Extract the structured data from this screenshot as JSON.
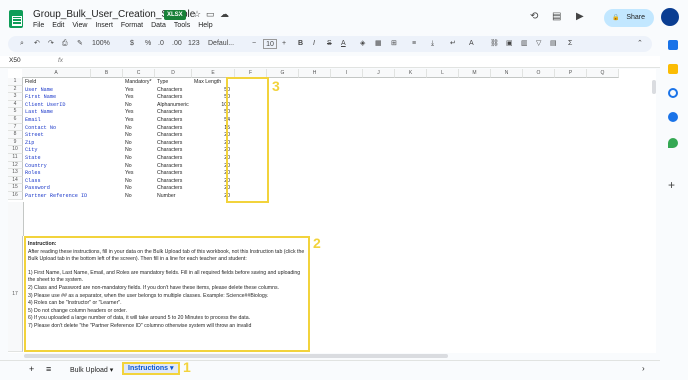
{
  "title": "Group_Bulk_User_Creation_Sample",
  "badge": "XLSX",
  "menu": [
    "File",
    "Edit",
    "View",
    "Insert",
    "Format",
    "Data",
    "Tools",
    "Help"
  ],
  "share": "Share",
  "toolbar": {
    "zoom": "100%",
    "font": "Defaul...",
    "size": "10",
    "currency": "$",
    "percent": "%",
    "dec1": ".0",
    "dec2": ".00",
    "fmt": "123"
  },
  "namebox": "X50",
  "fx": "fx",
  "columns": [
    "A",
    "B",
    "C",
    "D",
    "E",
    "F",
    "G",
    "H",
    "I",
    "J",
    "K",
    "L",
    "M",
    "N",
    "O",
    "P",
    "Q"
  ],
  "rows": [
    [
      "Field",
      "Mandatory*",
      "Type",
      "Max Length"
    ],
    [
      "User Name",
      "Yes",
      "Characters",
      "50"
    ],
    [
      "First Name",
      "Yes",
      "Characters",
      "50"
    ],
    [
      "Client UserID",
      "No",
      "Alphanumeric",
      "100"
    ],
    [
      "Last Name",
      "Yes",
      "Characters",
      "50"
    ],
    [
      "Email",
      "Yes",
      "Characters",
      "54"
    ],
    [
      "Contact No",
      "No",
      "Characters",
      "15"
    ],
    [
      "Street",
      "No",
      "Characters",
      "20"
    ],
    [
      "Zip",
      "No",
      "Characters",
      "20"
    ],
    [
      "City",
      "No",
      "Characters",
      "20"
    ],
    [
      "State",
      "No",
      "Characters",
      "20"
    ],
    [
      "Country",
      "No",
      "Characters",
      "20"
    ],
    [
      "Roles",
      "Yes",
      "Characters",
      "20"
    ],
    [
      "Class",
      "No",
      "Characters",
      "20"
    ],
    [
      "Password",
      "No",
      "Characters",
      "20"
    ],
    [
      "Partner Reference ID",
      "No",
      "Number",
      "20"
    ]
  ],
  "row17": "17",
  "instructions": [
    "Instruction:",
    "After reading these instructions, fill in your data on the Bulk Upload tab of this workbook, not this Instruction tab (click the Bulk Upload tab in the bottom left of the screen). Then fill in a line for each teacher and student:",
    "",
    "1) First Name, Last Name, Email, and Roles are mandatory fields. Fill in all required fields before saving and uploading the sheet to the system.",
    "2) Class and Password are non-mandatory fields. If you don't have these items, please delete these columns.",
    "3) Please use ## as a separator, when the user belongs to multiple classes. Example: Science##Biology.",
    "4) Roles can be \"Instructor\" or \"Learner\".",
    "5) Do not change column headers or order.",
    "6) If you uploaded a large number of data, it will take around 5 to 20 Minutes to process the data.",
    "7) Please don't delete \"the \"Partner Reference ID\" columno otherwise system will throw an invalid"
  ],
  "marks": {
    "m1": "1",
    "m2": "2",
    "m3": "3"
  },
  "tabs": {
    "add": "+",
    "list": "≡",
    "bulk": "Bulk Upload",
    "instructions": "Instructions",
    "arrow": "▾"
  },
  "colors": {
    "accent": "#f2d33c",
    "link": "#1a37c9",
    "share": "#c2e7ff"
  }
}
